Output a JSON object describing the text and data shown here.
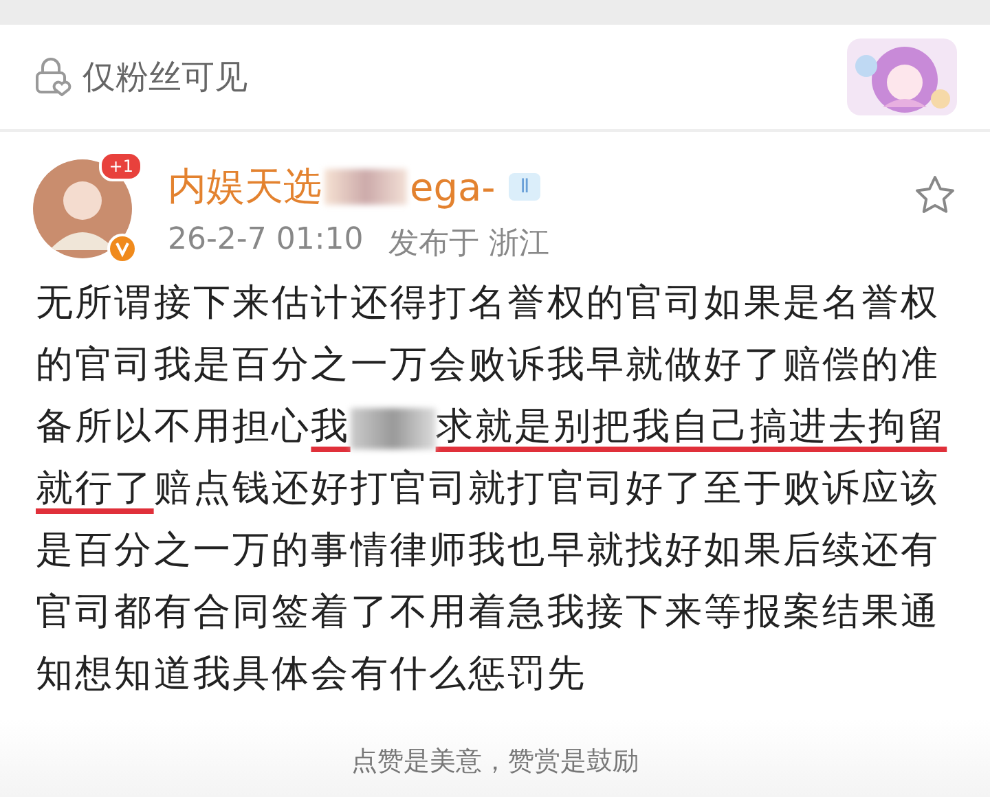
{
  "visibility": {
    "label": "仅粉丝可见"
  },
  "post": {
    "author": {
      "name_start": "内娱天选",
      "name_end": "ega-",
      "badge_count": "+1",
      "verified": true,
      "level_badge": "Ⅱ"
    },
    "time": "26-2-7 01:10",
    "location": "发布于 浙江",
    "favorited": false,
    "text": [
      {
        "kind": "text",
        "text": "无所谓接下来估计还得打名誉权的官司如果是名誉权的官司我是百分之一万会败诉我早就做好了赔偿的准备所以不用担心",
        "marked": false
      },
      {
        "kind": "text",
        "text": "我",
        "marked": true
      },
      {
        "kind": "redacted"
      },
      {
        "kind": "text",
        "text": "求就是别把我自己搞进去拘留就行了",
        "marked": true
      },
      {
        "kind": "text",
        "text": "赔点钱还好打官司就打官司好了至于败诉应该是百分之一万的事情律师我也早就找好如果后续还有官司都有合同签着了不用着急我接下来等报案结果通知想知道我具体会有什么惩罚先",
        "marked": false
      }
    ]
  },
  "footer": {
    "text": "点赞是美意，赞赏是鼓励"
  }
}
